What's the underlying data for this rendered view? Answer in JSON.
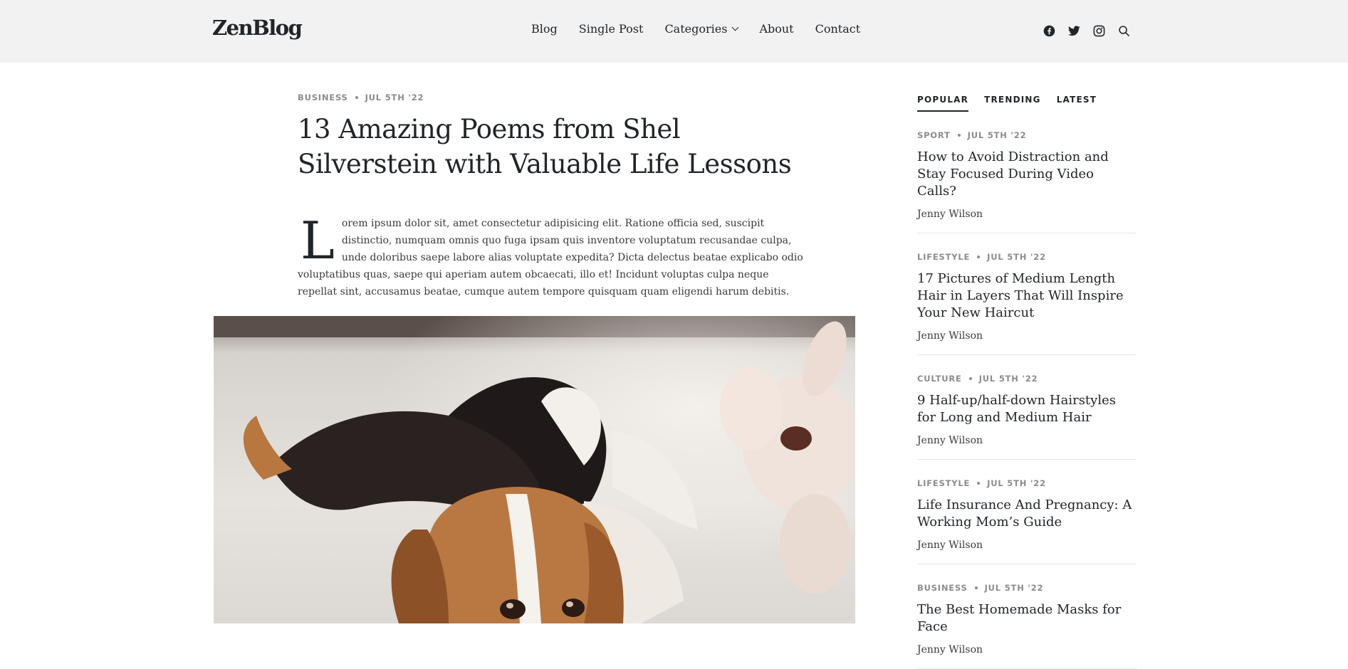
{
  "header": {
    "logo": "ZenBlog",
    "nav": [
      {
        "label": "Blog"
      },
      {
        "label": "Single Post"
      },
      {
        "label": "Categories"
      },
      {
        "label": "About"
      },
      {
        "label": "Contact"
      }
    ],
    "icons": [
      "facebook-icon",
      "twitter-icon",
      "instagram-icon",
      "search-icon"
    ]
  },
  "post": {
    "category": "Business",
    "date": "Jul 5th '22",
    "title": "13 Amazing Poems from Shel Silverstein with Valuable Life Lessons",
    "dropcap": "L",
    "body": "orem ipsum dolor sit, amet consectetur adipisicing elit. Ratione officia sed, suscipit distinctio, numquam omnis quo fuga ipsam quis inventore voluptatum recusandae culpa, unde doloribus saepe labore alias voluptate expedita? Dicta delectus beatae explicabo odio voluptatibus quas, saepe qui aperiam autem obcaecati, illo et! Incidunt voluptas culpa neque repellat sint, accusamus beatae, cumque autem tempore quisquam quam eligendi harum debitis."
  },
  "sidebar": {
    "tabs": [
      {
        "label": "POPULAR"
      },
      {
        "label": "TRENDING"
      },
      {
        "label": "LATEST"
      }
    ],
    "posts": [
      {
        "category": "Sport",
        "date": "Jul 5th '22",
        "title": "How to Avoid Distraction and Stay Focused During Video Calls?",
        "author": "Jenny Wilson"
      },
      {
        "category": "Lifestyle",
        "date": "Jul 5th '22",
        "title": "17 Pictures of Medium Length Hair in Layers That Will Inspire Your New Haircut",
        "author": "Jenny Wilson"
      },
      {
        "category": "Culture",
        "date": "Jul 5th '22",
        "title": "9 Half-up/half-down Hairstyles for Long and Medium Hair",
        "author": "Jenny Wilson"
      },
      {
        "category": "Lifestyle",
        "date": "Jul 5th '22",
        "title": "Life Insurance And Pregnancy: A Working Mom’s Guide",
        "author": "Jenny Wilson"
      },
      {
        "category": "Business",
        "date": "Jul 5th '22",
        "title": "The Best Homemade Masks for Face",
        "author": "Jenny Wilson"
      }
    ]
  },
  "colors": {
    "header_bg": "#f2f2f2",
    "text": "#212529",
    "meta": "#8c8c8c"
  }
}
